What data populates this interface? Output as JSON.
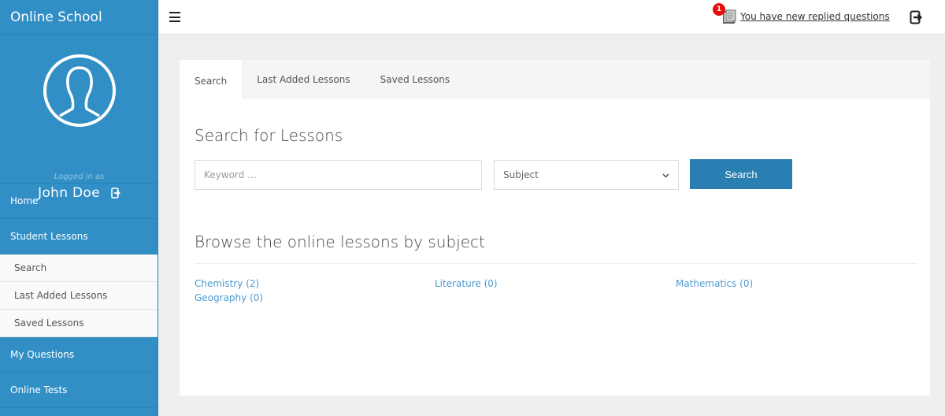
{
  "app": {
    "title": "Online School"
  },
  "colors": {
    "sidebar": "#318fc5",
    "accent": "#2a7fb2",
    "link": "#4b9bd0",
    "badge": "#e60c0c"
  },
  "profile": {
    "avatar_icon": "user-circle-icon",
    "logged_in_label": "Logged in as",
    "username": "John Doe",
    "logout_icon": "sign-out-icon"
  },
  "sidebar": {
    "items": [
      {
        "label": "Home",
        "type": "main"
      },
      {
        "label": "Student Lessons",
        "type": "main"
      },
      {
        "label": "Search",
        "type": "sub"
      },
      {
        "label": "Last Added Lessons",
        "type": "sub"
      },
      {
        "label": "Saved Lessons",
        "type": "sub"
      },
      {
        "label": "My Questions",
        "type": "main"
      },
      {
        "label": "Online Tests",
        "type": "main"
      }
    ]
  },
  "topbar": {
    "menu_icon": "hamburger-icon",
    "notification": {
      "count": "1",
      "text": "You have new replied questions",
      "icon": "document-icon"
    },
    "logout_icon": "sign-out-icon"
  },
  "tabs": [
    {
      "label": "Search",
      "active": true
    },
    {
      "label": "Last Added Lessons",
      "active": false
    },
    {
      "label": "Saved Lessons",
      "active": false
    }
  ],
  "search": {
    "heading": "Search for Lessons",
    "keyword_placeholder": "Keyword ...",
    "keyword_value": "",
    "subject_selected": "Subject",
    "button_label": "Search"
  },
  "browse": {
    "heading": "Browse the online lessons by subject",
    "subjects": [
      {
        "label": "Chemistry (2)"
      },
      {
        "label": "Literature (0)"
      },
      {
        "label": "Mathematics (0)"
      },
      {
        "label": "Geography (0)"
      }
    ]
  }
}
